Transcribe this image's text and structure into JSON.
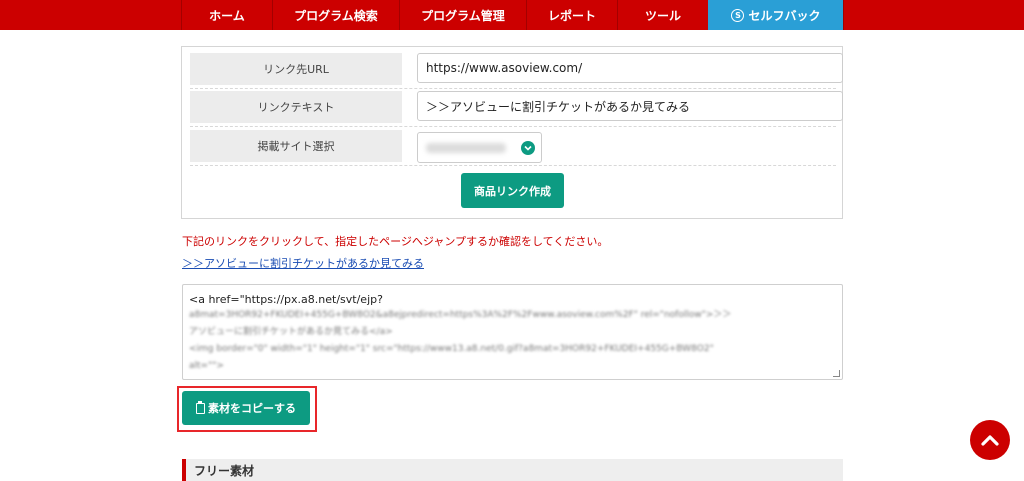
{
  "nav": {
    "items": [
      {
        "label": "ホーム"
      },
      {
        "label": "プログラム検索"
      },
      {
        "label": "プログラム管理"
      },
      {
        "label": "レポート"
      },
      {
        "label": "ツール"
      },
      {
        "label": "セルフバック"
      }
    ],
    "self_mark": "S"
  },
  "form": {
    "url_label": "リンク先URL",
    "url_value": "https://www.asoview.com/",
    "text_label": "リンクテキスト",
    "text_value": "＞＞アソビューに割引チケットがあるか見てみる",
    "site_label": "掲載サイト選択",
    "create_button": "商品リンク作成"
  },
  "notice": "下記のリンクをクリックして、指定したページへジャンプするか確認をしてください。",
  "preview_link": "＞＞アソビューに割引チケットがあるか見てみる",
  "code": {
    "line1": "<a href=\"https://px.a8.net/svt/ejp?",
    "blurred": [
      "a8mat=3HOR92+FKUDEI+455G+BW8O2&a8ejpredirect=https%3A%2F%2Fwww.asoview.com%2F\" rel=\"nofollow\">＞＞",
      "アソビューに割引チケットがあるか見てみる</a>",
      "<img border=\"0\" width=\"1\" height=\"1\" src=\"https://www13.a8.net/0.gif?a8mat=3HOR92+FKUDEI+455G+BW8O2\"",
      "alt=\"\">"
    ]
  },
  "copy_button": "素材をコピーする",
  "free_section_title": "フリー素材",
  "colors": {
    "brand_red": "#cc0000",
    "accent_blue": "#2a9fd6",
    "button_green": "#0d9b82",
    "highlight_frame": "#e8262a"
  }
}
